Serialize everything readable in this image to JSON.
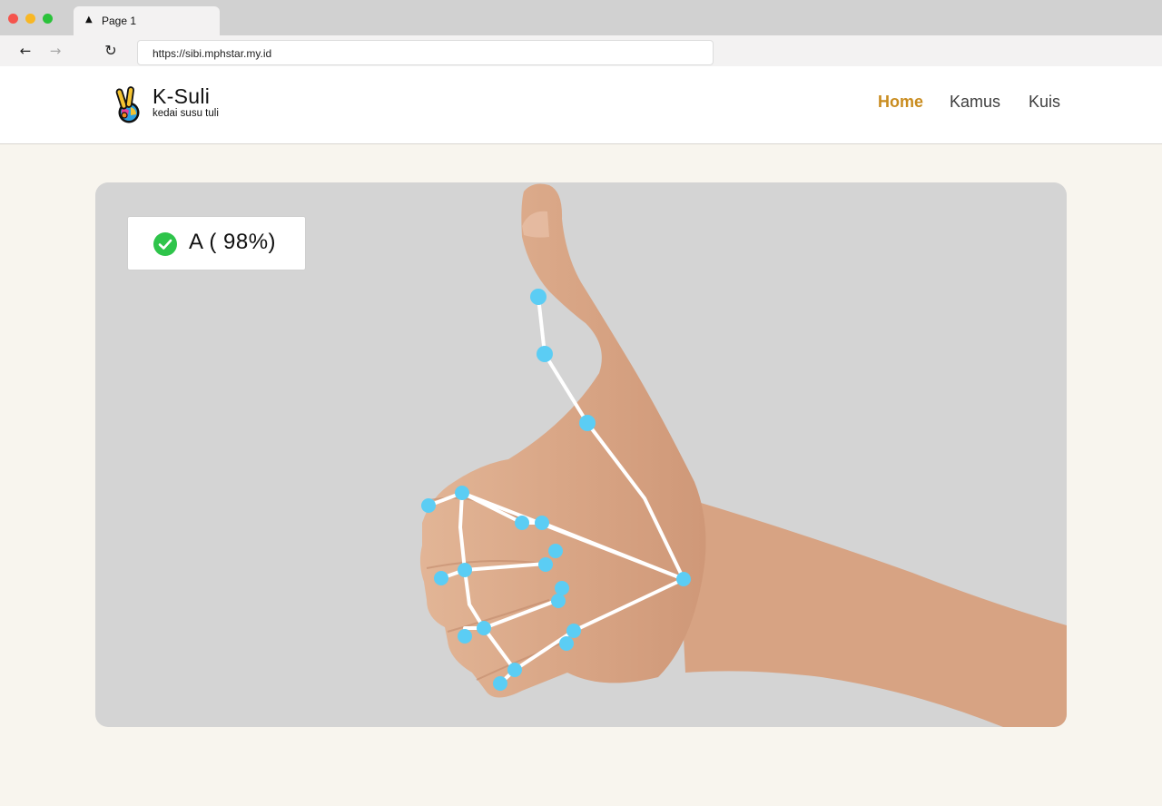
{
  "browser": {
    "tab_title": "Page 1",
    "tab_icon": "triangle-icon",
    "url": "https://sibi.mphstar.my.id",
    "back_icon": "arrow-left-icon",
    "forward_icon": "arrow-right-icon",
    "reload_icon": "reload-icon"
  },
  "site": {
    "brand_name": "K-Suli",
    "brand_tagline": "kedai susu tuli",
    "nav": {
      "home": "Home",
      "kamus": "Kamus",
      "kuis": "Kuis"
    },
    "active_nav": "Home",
    "accent_color": "#c98c1f"
  },
  "detection": {
    "result_label": "A ( 98%)",
    "letter": "A",
    "confidence_percent": 98,
    "status_icon": "check-circle-icon",
    "status_color": "#2ec44a",
    "landmark_color": "#5bcdf4"
  }
}
